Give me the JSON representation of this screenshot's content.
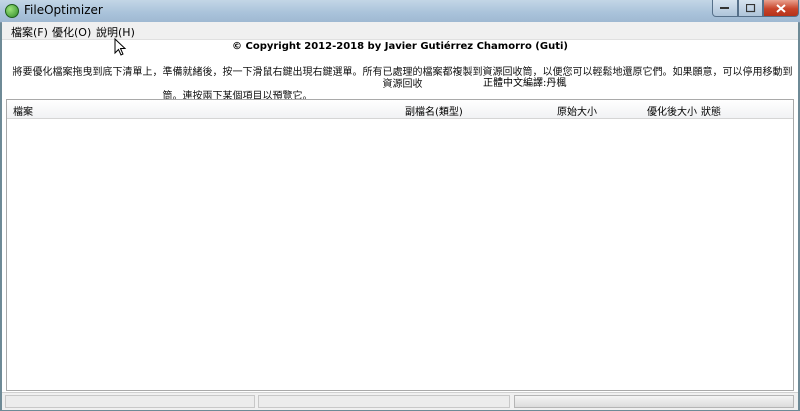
{
  "window": {
    "title": "FileOptimizer"
  },
  "menu": [
    {
      "label": "檔案(F)"
    },
    {
      "label": "優化(O)"
    },
    {
      "label": "說明(H)"
    }
  ],
  "copyright": "© Copyright 2012-2018 by Javier Gutiérrez Chamorro (Guti)",
  "instructions": {
    "line1": "將要優化檔案拖曳到底下清單上，準備就緒後，按一下滑鼠右鍵出現右鍵選單。所有已處理的檔案都複製到資源回收筒，以便您可以輕鬆地還原它們。如果願意，可以停用移動到資源回收",
    "line2": "筒。連按兩下某個項目以預覽它。"
  },
  "translator": "正體中文編譯:丹楓",
  "columns": [
    "檔案",
    "副檔名(類型)",
    "原始大小",
    "優化後大小",
    "狀態"
  ]
}
